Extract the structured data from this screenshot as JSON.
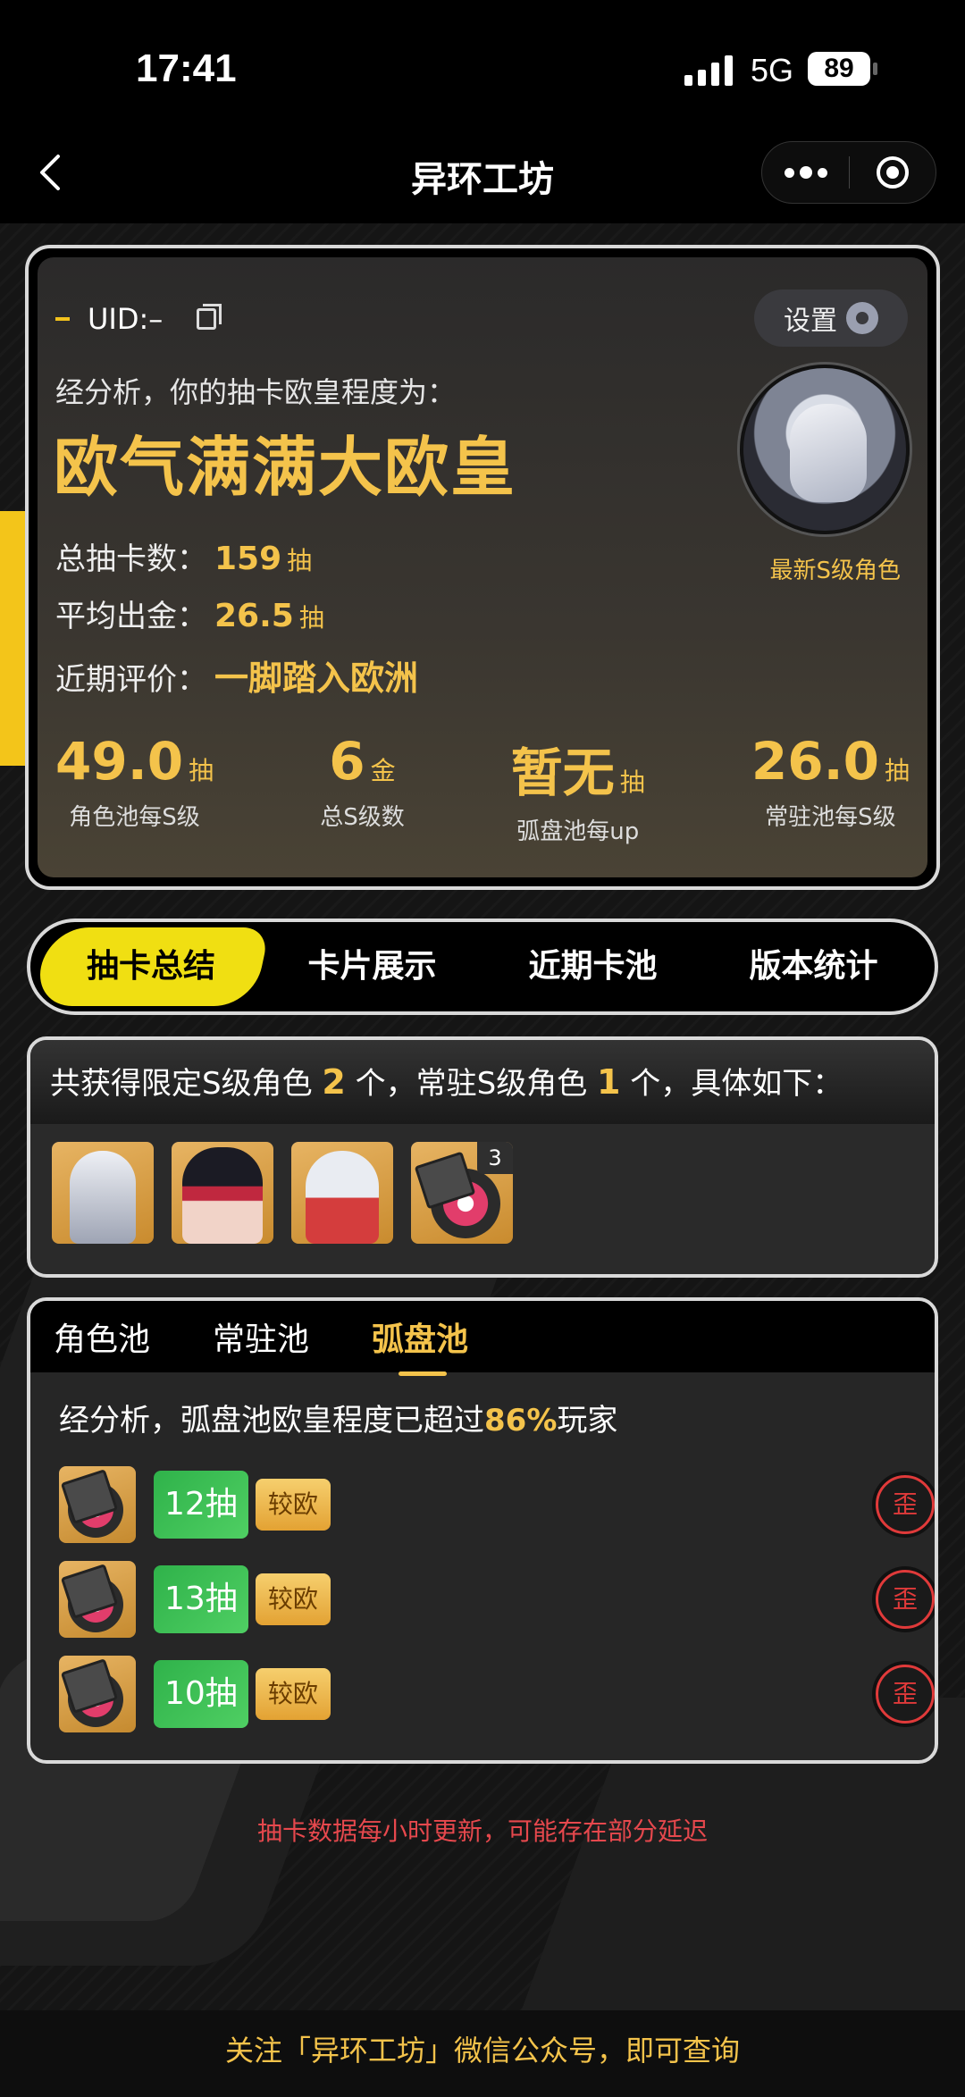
{
  "status_bar": {
    "time": "17:41",
    "network": "5G",
    "battery": "89"
  },
  "nav": {
    "title": "异环工坊"
  },
  "profile": {
    "uid_label": "UID:–",
    "settings_label": "设置",
    "analysis_text": "经分析，你的抽卡欧皇程度为：",
    "rank_title": "欧气满满大欧皇",
    "total_pulls_label": "总抽卡数：",
    "total_pulls_value": "159",
    "total_pulls_unit": "抽",
    "avg_label": "平均出金：",
    "avg_value": "26.5",
    "avg_unit": "抽",
    "eval_label": "近期评价：",
    "eval_value": "一脚踏入欧洲",
    "latest_label": "最新S级角色",
    "stats": [
      {
        "value": "49.0",
        "unit": "抽",
        "label": "角色池每S级"
      },
      {
        "value": "6",
        "unit": "金",
        "label": "总S级数"
      },
      {
        "value": "暂无",
        "unit": "抽",
        "label": "弧盘池每up"
      },
      {
        "value": "26.0",
        "unit": "抽",
        "label": "常驻池每S级"
      }
    ]
  },
  "tabs": [
    "抽卡总结",
    "卡片展示",
    "近期卡池",
    "版本统计"
  ],
  "obtained": {
    "pre": "共获得限定S级角色 ",
    "limited_count": "2",
    "mid": " 个，常驻S级角色 ",
    "standard_count": "1",
    "post": " 个，具体如下：",
    "extra_count": "3"
  },
  "pool": {
    "tabs": [
      "角色池",
      "常驻池",
      "弧盘池"
    ],
    "summary_pre": "经分析，弧盘池欧皇程度已超过",
    "summary_pct": "86%",
    "summary_post": "玩家",
    "rows": [
      {
        "pulls": "12抽",
        "tag": "较欧"
      },
      {
        "pulls": "13抽",
        "tag": "较欧"
      },
      {
        "pulls": "10抽",
        "tag": "较欧"
      }
    ],
    "walk_glyph": "歪"
  },
  "note": "抽卡数据每小时更新，可能存在部分延迟",
  "footer": "关注「异环工坊」微信公众号，即可查询",
  "colors": {
    "accent": "#f4c34b",
    "tab_active": "#f0df12",
    "green": "#2fb24a",
    "red": "#e03a3a"
  }
}
